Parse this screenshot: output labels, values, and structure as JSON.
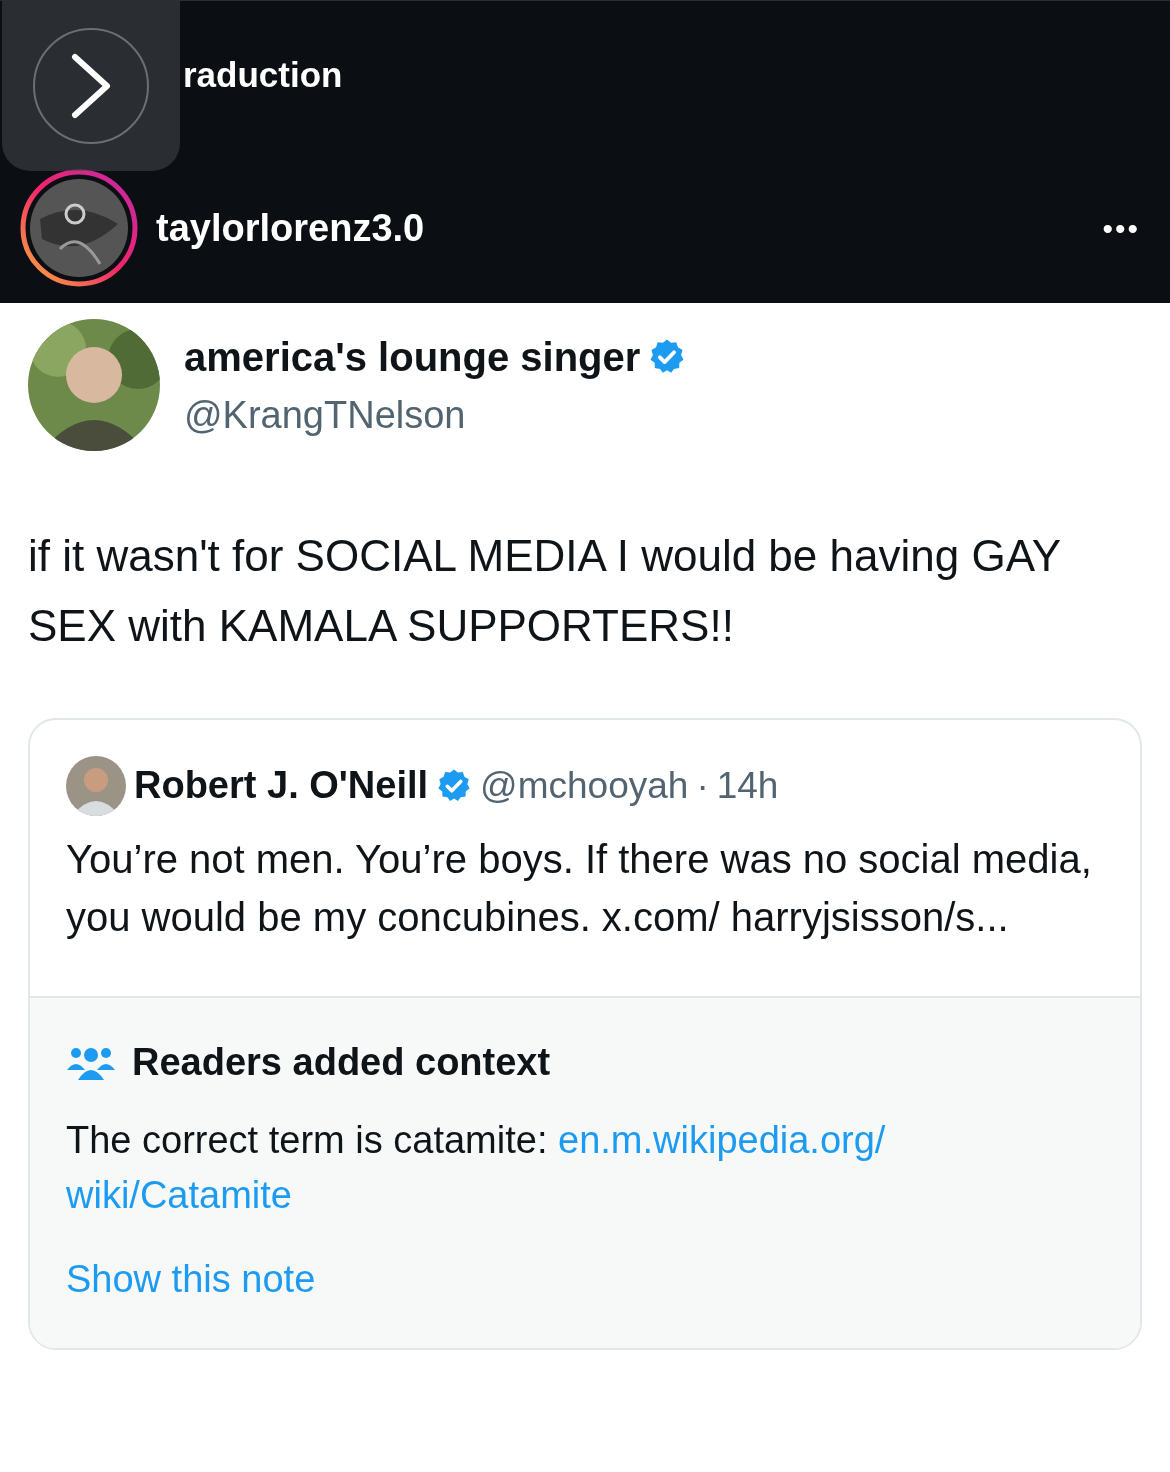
{
  "post_header": {
    "translation_link": "raduction",
    "username": "taylorlorenz3.0",
    "more": "•••"
  },
  "tweet": {
    "display_name": "america's lounge singer",
    "verified": true,
    "handle": "@KrangTNelson",
    "text": "if it wasn't for SOCIAL MEDIA I would be having GAY SEX with KAMALA SUPPORTERS!!",
    "quoted": {
      "display_name": "Robert J. O'Neill",
      "verified": true,
      "handle": "@mchooyah",
      "separator": "·",
      "time": "14h",
      "text": "You’re not men. You’re boys. If there was no social media, you would be my concubines. x.com/ harryjsisson/s...",
      "note": {
        "title": "Readers added context",
        "text": "The correct term is catamite: ",
        "link_lines": [
          "en.m.wikipedia.org/",
          "wiki/Catamite"
        ],
        "action": "Show this note"
      }
    }
  }
}
